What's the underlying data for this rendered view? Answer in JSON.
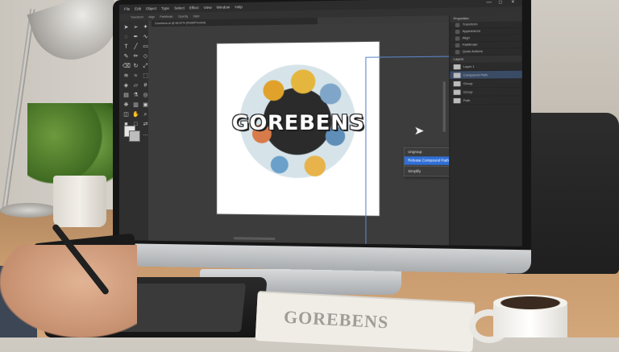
{
  "app": {
    "menu": [
      "File",
      "Edit",
      "Object",
      "Type",
      "Select",
      "Effect",
      "View",
      "Window",
      "Help"
    ],
    "options_bar": [
      "Transform",
      "Align",
      "Pathfinder",
      "Opacity",
      "Style"
    ],
    "document_tab": "Gorebens.ai @ 66.67% (RGB/Preview)",
    "window_controls": [
      "—",
      "□",
      "×"
    ]
  },
  "toolbar": {
    "tools": [
      "selection-tool",
      "direct-selection-tool",
      "magic-wand-tool",
      "lasso-tool",
      "pen-tool",
      "curvature-tool",
      "type-tool",
      "line-tool",
      "rectangle-tool",
      "paintbrush-tool",
      "pencil-tool",
      "shaper-tool",
      "eraser-tool",
      "rotate-tool",
      "scale-tool",
      "width-tool",
      "warp-tool",
      "free-transform-tool",
      "shape-builder-tool",
      "perspective-tool",
      "mesh-tool",
      "gradient-tool",
      "eyedropper-tool",
      "blend-tool",
      "symbol-tool",
      "graph-tool",
      "artboard-tool",
      "slice-tool",
      "hand-tool",
      "zoom-tool",
      "fill-swatch",
      "stroke-swatch",
      "swap-icon",
      "draw-mode",
      "screen-mode",
      "edit-toolbar"
    ],
    "glyphs": [
      "➤",
      "➢",
      "✦",
      "◌",
      "✒",
      "∿",
      "T",
      "╱",
      "▭",
      "✎",
      "✏",
      "◇",
      "⌫",
      "↻",
      "⤢",
      "≋",
      "≈",
      "⬚",
      "◈",
      "▱",
      "#",
      "▤",
      "⚗",
      "◎",
      "❋",
      "▥",
      "▣",
      "◫",
      "✋",
      "⌕",
      "■",
      "□",
      "⇄",
      "◐",
      "▢",
      "…"
    ]
  },
  "artwork": {
    "title": "GOREBENS"
  },
  "context_menu": {
    "items": [
      "Ungroup",
      "Release Compound Path",
      "Simplify"
    ],
    "active_index": 1
  },
  "panels": {
    "properties": "Properties",
    "layers": "Layers",
    "rows": [
      "Transform",
      "Appearance",
      "Align",
      "Pathfinder",
      "Quick Actions"
    ],
    "layer_items": [
      "Layer 1",
      "Compound Path",
      "Group",
      "Group",
      "Path"
    ],
    "selected_layer_index": 1
  }
}
